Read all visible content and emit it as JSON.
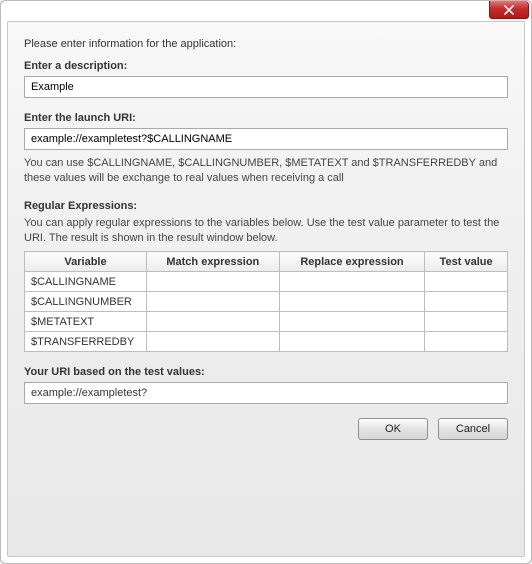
{
  "intro": "Please enter information for the application:",
  "desc": {
    "label": "Enter a description:",
    "value": "Example"
  },
  "uri": {
    "label": "Enter the launch URI:",
    "value": "example://exampletest?$CALLINGNAME",
    "hint": "You can use $CALLINGNAME, $CALLINGNUMBER, $METATEXT and $TRANSFERREDBY and these values will be exchange to real values when receiving a call"
  },
  "regex": {
    "label": "Regular Expressions:",
    "hint": "You can apply regular expressions to the variables below. Use the test value parameter to test the URI. The result is shown in the result window below.",
    "columns": [
      "Variable",
      "Match expression",
      "Replace expression",
      "Test value"
    ],
    "rows": [
      {
        "variable": "$CALLINGNAME",
        "match": "",
        "replace": "",
        "test": ""
      },
      {
        "variable": "$CALLINGNUMBER",
        "match": "",
        "replace": "",
        "test": ""
      },
      {
        "variable": "$METATEXT",
        "match": "",
        "replace": "",
        "test": ""
      },
      {
        "variable": "$TRANSFERREDBY",
        "match": "",
        "replace": "",
        "test": ""
      }
    ]
  },
  "result": {
    "label": "Your URI based on the test values:",
    "value": "example://exampletest?"
  },
  "buttons": {
    "ok": "OK",
    "cancel": "Cancel"
  }
}
